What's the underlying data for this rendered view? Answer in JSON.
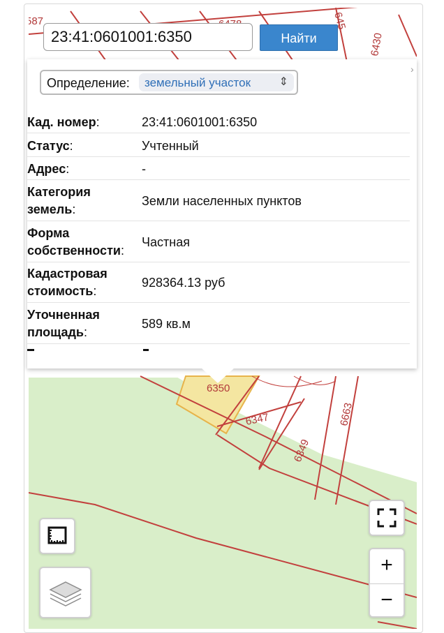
{
  "search": {
    "query": "23:41:0601001:6350",
    "button_label": "Найти"
  },
  "definition": {
    "label": "Определение:",
    "selected_value": "земельный участок"
  },
  "info_rows": [
    {
      "key": "Кад. номер",
      "colon": ":",
      "value": "23:41:0601001:6350"
    },
    {
      "key": "Статус",
      "colon": ":",
      "value": "Учтенный"
    },
    {
      "key": "Адрес",
      "colon": ":",
      "value": "-"
    },
    {
      "key_line1": "Категория",
      "key_line2": "земель",
      "colon": ":",
      "value": "Земли населенных пунктов"
    },
    {
      "key_line1": "Форма",
      "key_line2": "собственности",
      "colon": ":",
      "value": "Частная"
    },
    {
      "key_line1": "Кадастровая",
      "key_line2": "стоимость",
      "colon": ":",
      "value": "928364.13 руб"
    },
    {
      "key_line1": "Уточненная",
      "key_line2": "площадь",
      "colon": ":",
      "value": "589 кв.м"
    }
  ],
  "map": {
    "parcel_labels": [
      "6350",
      "6347",
      "6349",
      "6663",
      "6430",
      "6478",
      "587",
      "645"
    ],
    "colors": {
      "green_area": "#d9eec9",
      "boundary": "#c2403d",
      "selected_fill": "#f4e6a1",
      "selected_stroke": "#e7b34a",
      "accent": "#3a86cd"
    }
  },
  "controls": {
    "zoom_in": "+",
    "zoom_out": "−"
  }
}
